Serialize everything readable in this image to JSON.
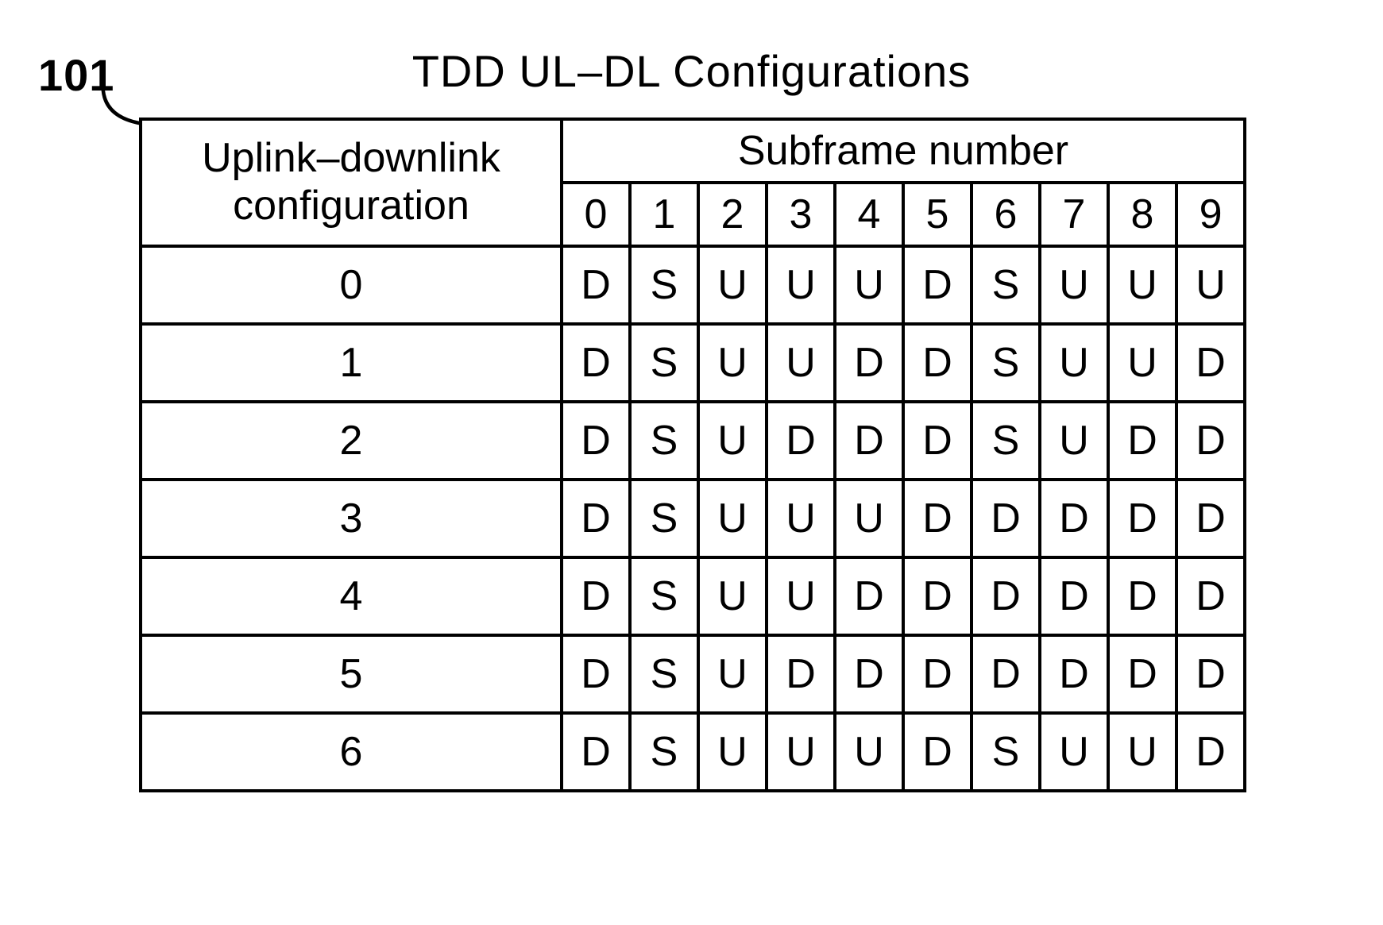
{
  "ref_number": "101",
  "title": "TDD UL–DL Configurations",
  "headers": {
    "config_line1": "Uplink–downlink",
    "config_line2": "configuration",
    "subframe": "Subframe number",
    "cols": [
      "0",
      "1",
      "2",
      "3",
      "4",
      "5",
      "6",
      "7",
      "8",
      "9"
    ]
  },
  "rows": [
    {
      "cfg": "0",
      "cells": [
        "D",
        "S",
        "U",
        "U",
        "U",
        "D",
        "S",
        "U",
        "U",
        "U"
      ]
    },
    {
      "cfg": "1",
      "cells": [
        "D",
        "S",
        "U",
        "U",
        "D",
        "D",
        "S",
        "U",
        "U",
        "D"
      ]
    },
    {
      "cfg": "2",
      "cells": [
        "D",
        "S",
        "U",
        "D",
        "D",
        "D",
        "S",
        "U",
        "D",
        "D"
      ]
    },
    {
      "cfg": "3",
      "cells": [
        "D",
        "S",
        "U",
        "U",
        "U",
        "D",
        "D",
        "D",
        "D",
        "D"
      ]
    },
    {
      "cfg": "4",
      "cells": [
        "D",
        "S",
        "U",
        "U",
        "D",
        "D",
        "D",
        "D",
        "D",
        "D"
      ]
    },
    {
      "cfg": "5",
      "cells": [
        "D",
        "S",
        "U",
        "D",
        "D",
        "D",
        "D",
        "D",
        "D",
        "D"
      ]
    },
    {
      "cfg": "6",
      "cells": [
        "D",
        "S",
        "U",
        "U",
        "U",
        "D",
        "S",
        "U",
        "U",
        "D"
      ]
    }
  ],
  "chart_data": {
    "type": "table",
    "title": "TDD UL–DL Configurations",
    "xlabel": "Subframe number",
    "ylabel": "Uplink–downlink configuration",
    "categories": [
      "0",
      "1",
      "2",
      "3",
      "4",
      "5",
      "6",
      "7",
      "8",
      "9"
    ],
    "series": [
      {
        "name": "0",
        "values": [
          "D",
          "S",
          "U",
          "U",
          "U",
          "D",
          "S",
          "U",
          "U",
          "U"
        ]
      },
      {
        "name": "1",
        "values": [
          "D",
          "S",
          "U",
          "U",
          "D",
          "D",
          "S",
          "U",
          "U",
          "D"
        ]
      },
      {
        "name": "2",
        "values": [
          "D",
          "S",
          "U",
          "D",
          "D",
          "D",
          "S",
          "U",
          "D",
          "D"
        ]
      },
      {
        "name": "3",
        "values": [
          "D",
          "S",
          "U",
          "U",
          "U",
          "D",
          "D",
          "D",
          "D",
          "D"
        ]
      },
      {
        "name": "4",
        "values": [
          "D",
          "S",
          "U",
          "U",
          "D",
          "D",
          "D",
          "D",
          "D",
          "D"
        ]
      },
      {
        "name": "5",
        "values": [
          "D",
          "S",
          "U",
          "D",
          "D",
          "D",
          "D",
          "D",
          "D",
          "D"
        ]
      },
      {
        "name": "6",
        "values": [
          "D",
          "S",
          "U",
          "U",
          "U",
          "D",
          "S",
          "U",
          "U",
          "D"
        ]
      }
    ]
  }
}
